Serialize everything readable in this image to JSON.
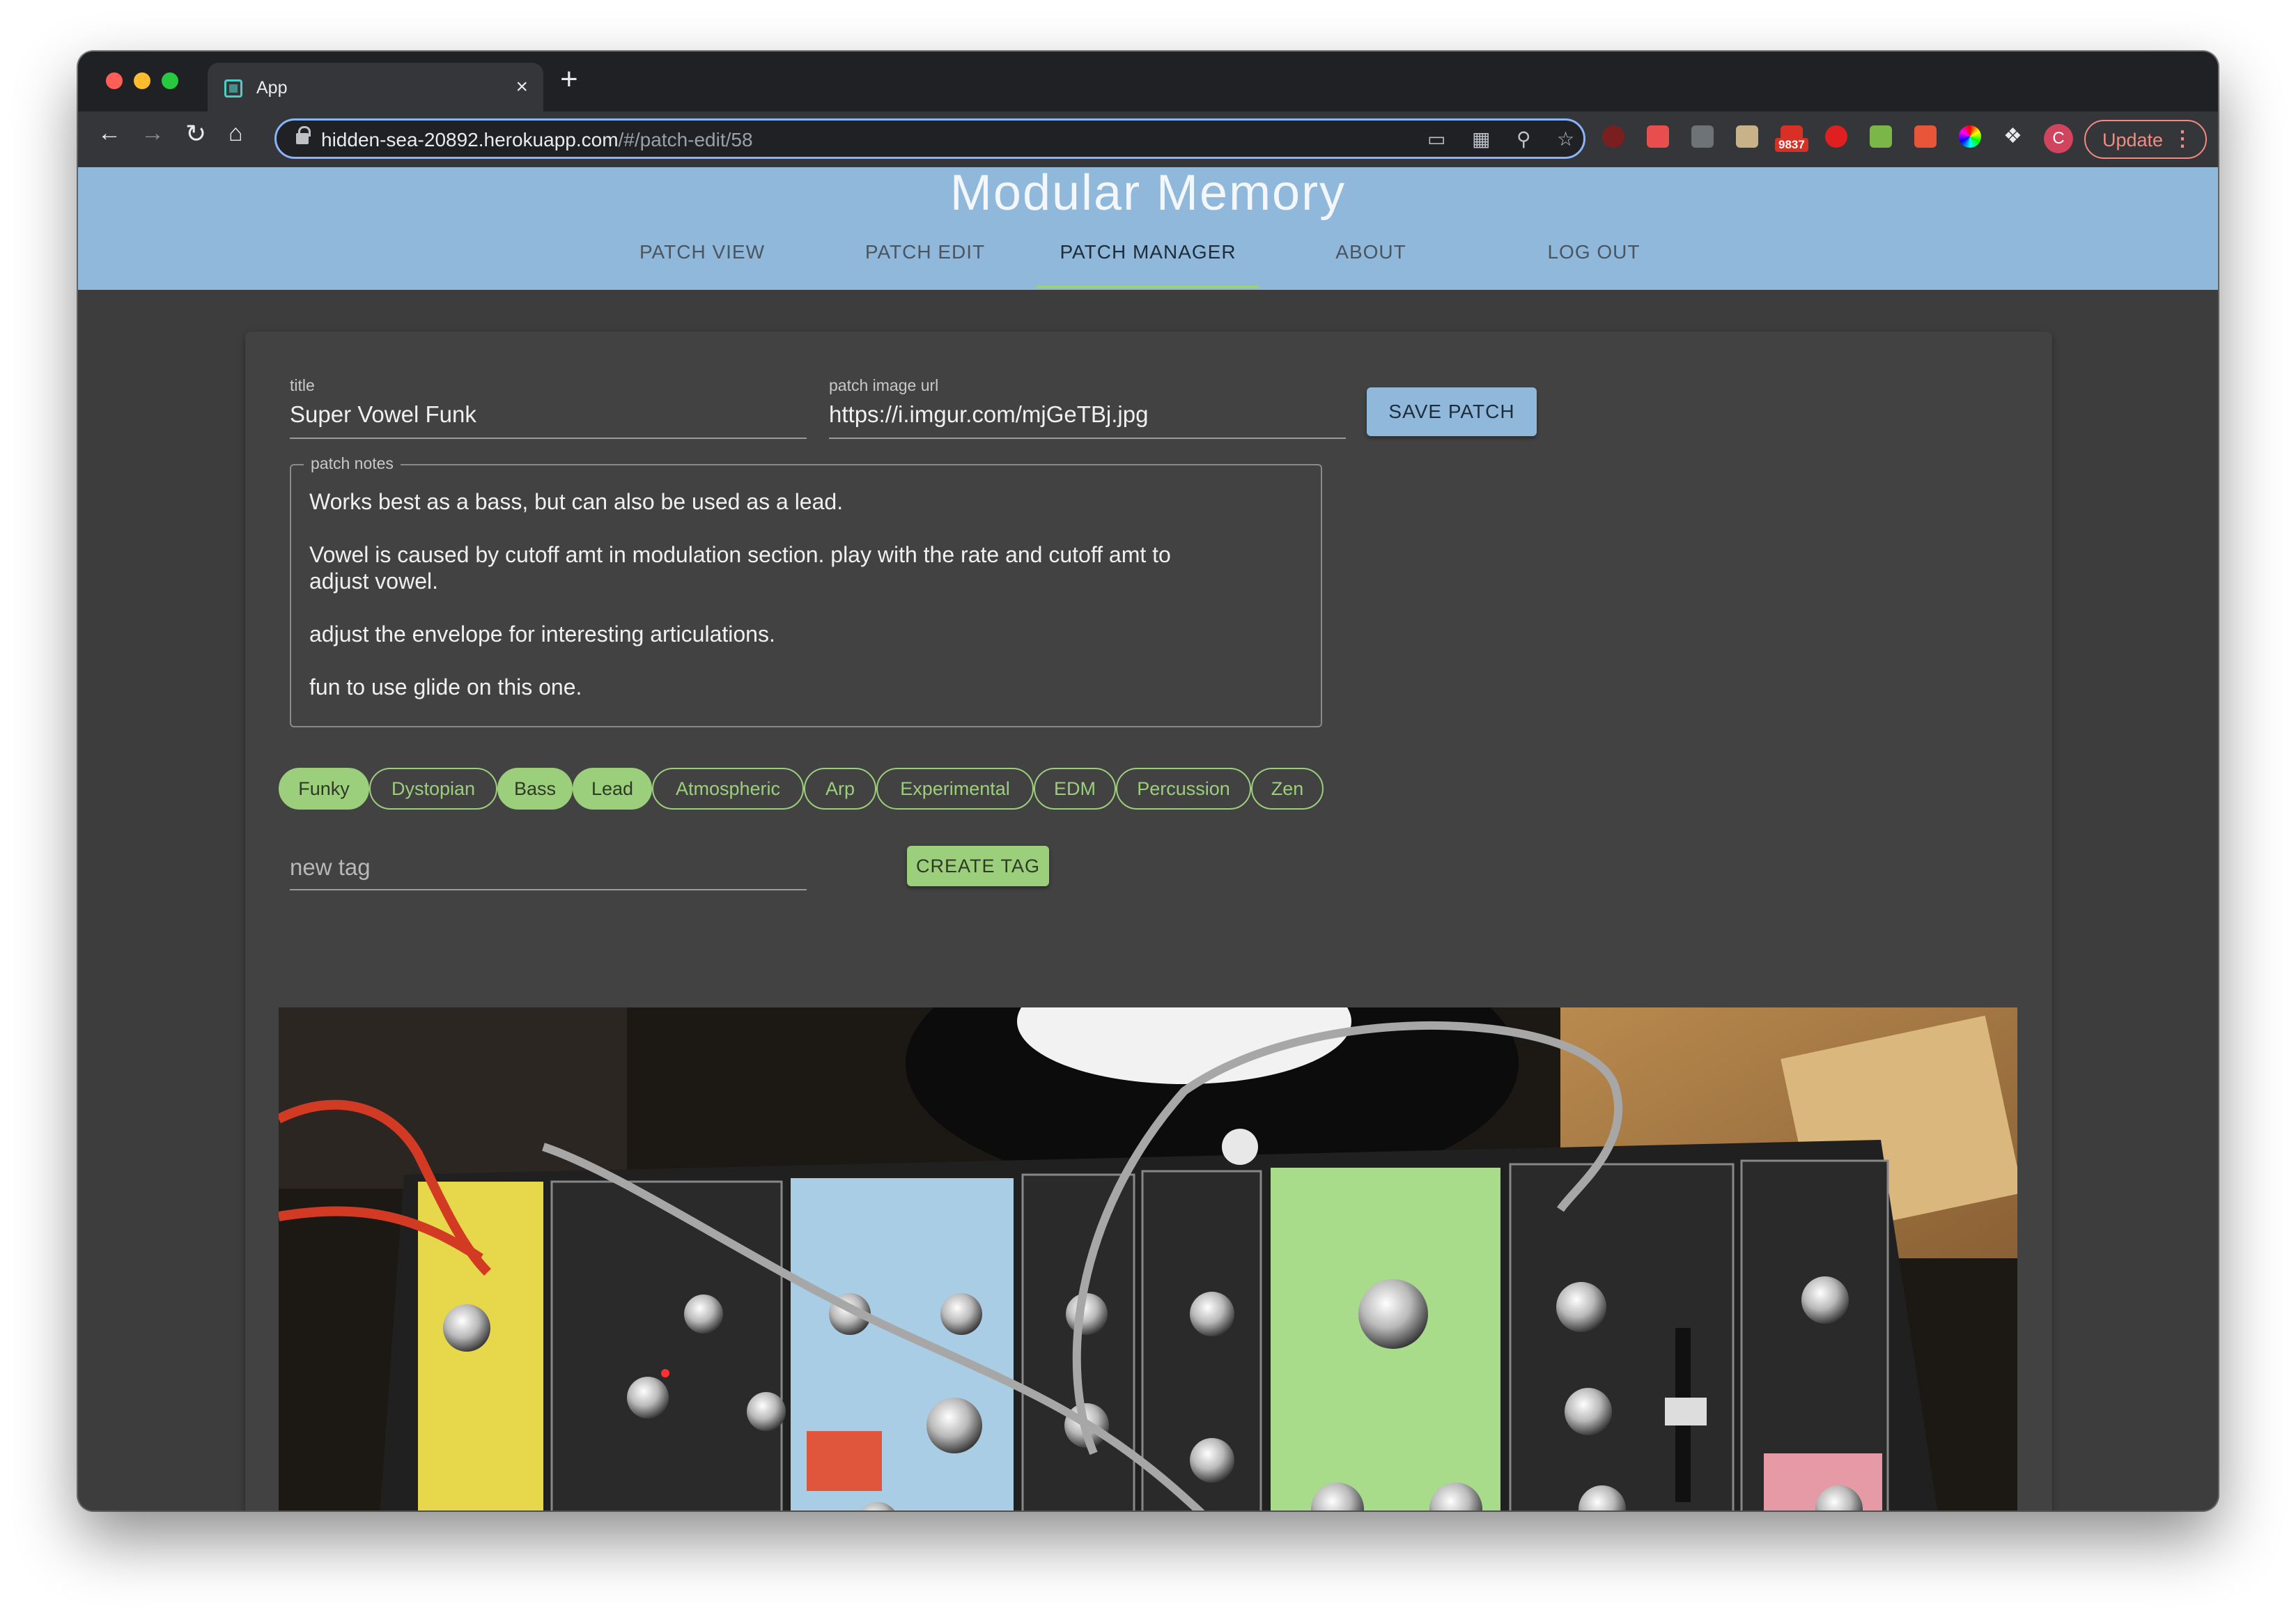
{
  "browser": {
    "tab_title": "App",
    "tab_close": "×",
    "new_tab": "+",
    "url_host": "hidden-sea-20892.herokuapp.com",
    "url_path": "/#/patch-edit/58",
    "badge_count": "9837",
    "profile_initial": "C",
    "update_label": "Update"
  },
  "app": {
    "title": "Modular Memory",
    "nav": [
      {
        "label": "PATCH VIEW"
      },
      {
        "label": "PATCH EDIT"
      },
      {
        "label": "PATCH MANAGER"
      },
      {
        "label": "ABOUT"
      },
      {
        "label": "LOG OUT"
      }
    ],
    "active_nav": "PATCH MANAGER"
  },
  "form": {
    "title_label": "title",
    "title_value": "Super Vowel Funk",
    "image_url_label": "patch image url",
    "image_url_value": "https://i.imgur.com/mjGeTBj.jpg",
    "save_label": "SAVE PATCH",
    "notes_label": "patch notes",
    "notes_lines": [
      "Works best as a bass, but can also be used as a lead.",
      "Vowel is caused by cutoff amt in modulation section. play with the rate and cutoff amt to",
      "adjust vowel.",
      "adjust the envelope for interesting articulations.",
      "fun to use glide on this one."
    ],
    "tags": [
      {
        "label": "Funky",
        "selected": true
      },
      {
        "label": "Dystopian",
        "selected": false
      },
      {
        "label": "Bass",
        "selected": true
      },
      {
        "label": "Lead",
        "selected": true
      },
      {
        "label": "Atmospheric",
        "selected": false
      },
      {
        "label": "Arp",
        "selected": false
      },
      {
        "label": "Experimental",
        "selected": false
      },
      {
        "label": "EDM",
        "selected": false
      },
      {
        "label": "Percussion",
        "selected": false
      },
      {
        "label": "Zen",
        "selected": false
      }
    ],
    "new_tag_placeholder": "new tag",
    "create_tag_label": "CREATE TAG"
  },
  "colors": {
    "header_bg": "#8fb8db",
    "accent_green": "#9ccf7b",
    "page_bg": "#3d3d3d",
    "card_bg": "#424242"
  }
}
